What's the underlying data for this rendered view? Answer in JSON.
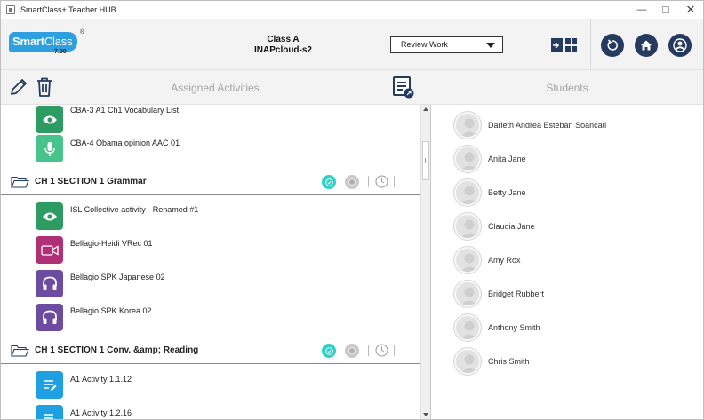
{
  "window": {
    "title": "SmartClass+ Teacher HUB",
    "controls": {
      "minimize": "—",
      "close": "✕"
    }
  },
  "header": {
    "logo": {
      "smart": "Smart",
      "class": "Class",
      "reg": "®",
      "version": "7.00"
    },
    "class_name": "Class A",
    "cloud_name": "INAPcloud-s2",
    "mode_select": "Review Work"
  },
  "toolbar": {
    "assigned_label": "Assigned Activities",
    "students_label": "Students"
  },
  "activities": {
    "top_items": [
      {
        "label": "CBA-3 A1 Ch1 Vocabulary List",
        "type": "view"
      },
      {
        "label": "CBA-4 Obama opinion AAC 01",
        "type": "mic"
      }
    ],
    "sections": [
      {
        "title": "CH 1 SECTION 1 Grammar",
        "items": [
          {
            "label": "ISL Collective activity - Renamed #1",
            "type": "view"
          },
          {
            "label": "Bellagio-Heidi VRec 01",
            "type": "video"
          },
          {
            "label": "Bellagio SPK Japanese 02",
            "type": "audio"
          },
          {
            "label": "Bellagio SPK Korea 02",
            "type": "audio"
          }
        ]
      },
      {
        "title": "CH 1 SECTION 1 Conv. &amp; Reading",
        "items": [
          {
            "label": "A1 Activity 1.1.12",
            "type": "document"
          },
          {
            "label": "A1 Activity 1.2.16",
            "type": "document"
          }
        ]
      }
    ]
  },
  "students": [
    "Darleth Andrea Esteban Soancatl",
    "Anita Jane",
    "Betty Jane",
    "Claudia Jane",
    "Amy Rox",
    "Bridget Rubbert",
    "Anthony Smith",
    "Chris Smith"
  ],
  "colors": {
    "accent_logo": "#2ea0e0",
    "header_buttons": "#243a5e",
    "view_icon": "#2e9b63",
    "mic_icon": "#47c48c",
    "video_icon": "#b03077",
    "audio_icon": "#6d4ba0",
    "document_icon": "#1fa0e2",
    "section_check": "#2fd0c8"
  }
}
